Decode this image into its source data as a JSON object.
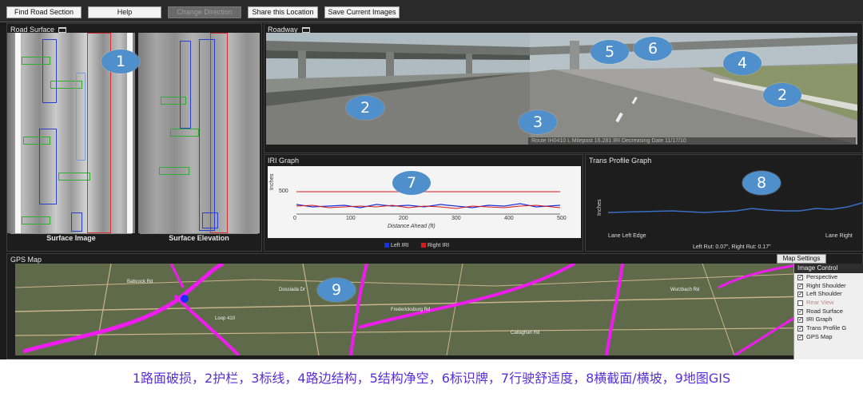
{
  "toolbar": {
    "find_road_section": "Find Road Section",
    "help": "Help",
    "change_direction": "Change Direction",
    "share_location": "Share this Location",
    "save_images": "Save Current Images"
  },
  "panels": {
    "road_surface": "Road Surface",
    "roadway": "Roadway",
    "iri_graph": "IRI Graph",
    "trans_profile": "Trans Profile Graph",
    "gps_map": "GPS Map"
  },
  "road_surface": {
    "surface_image": "Surface Image",
    "surface_elevation": "Surface Elevation"
  },
  "roadway_overlay": "Route IH0410 L     Milepost 16.281   IRI Decreasing   Date 11/17/10",
  "badges": {
    "b1": "1",
    "b2a": "2",
    "b2b": "2",
    "b3": "3",
    "b4": "4",
    "b5": "5",
    "b6": "6",
    "b7": "7",
    "b8": "8",
    "b9": "9"
  },
  "iri_graph": {
    "ylabel": "Inches",
    "y_tick": "500",
    "xlabel": "Distance Ahead (ft)",
    "x_ticks": [
      "0",
      "100",
      "200",
      "300",
      "400",
      "500"
    ],
    "legend_left": "Left IRI",
    "legend_right": "Right IRI",
    "left_color": "#1a33d6",
    "right_color": "#d61a1a"
  },
  "trans_profile": {
    "ylabel": "Inches",
    "left_edge": "Lane Left Edge",
    "right_edge": "Lane Right",
    "rut_text": "Left Rut: 0.07\", Right Rut: 0.17\""
  },
  "map": {
    "settings_button": "Map Settings",
    "labels": [
      "Dosslada Dr",
      "Loop 410",
      "Fredericksburg Rd",
      "Babcock Rd",
      "Callaghan Rd",
      "Wurzbach Rd"
    ]
  },
  "image_control": {
    "title": "Image Control",
    "items": [
      {
        "label": "Perspective",
        "checked": "✓"
      },
      {
        "label": "Right Shoulder",
        "checked": "✓"
      },
      {
        "label": "Left Shoulder",
        "checked": "✓"
      },
      {
        "label": "Rear View",
        "checked": ""
      },
      {
        "label": "Road Surface",
        "checked": "✓"
      },
      {
        "label": "IRI Graph",
        "checked": "✓"
      },
      {
        "label": "Trans Profile G",
        "checked": "✓"
      },
      {
        "label": "GPS Map",
        "checked": "✓"
      }
    ]
  },
  "caption": "1路面破损，2护栏，3标线，4路边结构，5结构净空，6标识牌，7行驶舒适度，8横截面/横坡，9地图GIS"
}
